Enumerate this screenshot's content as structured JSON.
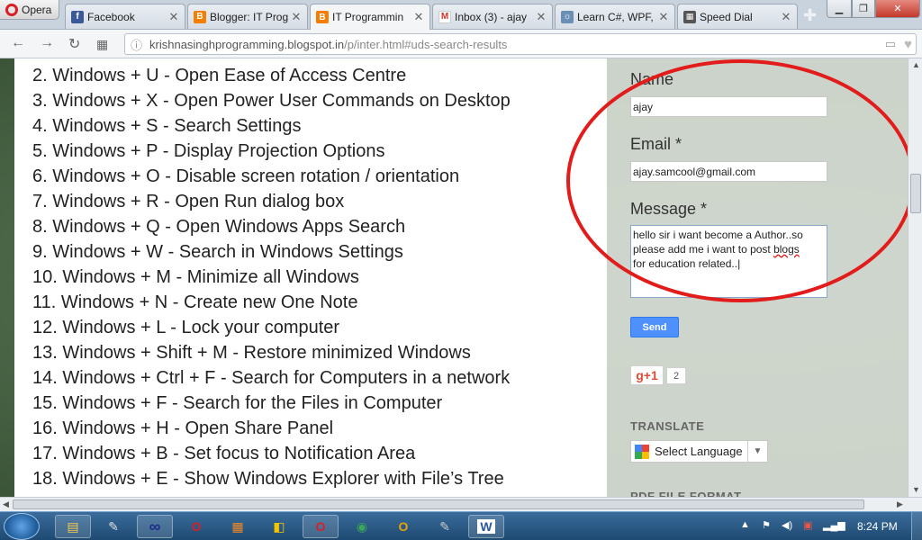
{
  "browser": {
    "menu_label": "Opera",
    "tabs": [
      {
        "label": "Facebook",
        "favicon": "facebook-icon",
        "color": "#3b5998"
      },
      {
        "label": "Blogger: IT Prog",
        "favicon": "blogger-icon",
        "color": "#f57d00"
      },
      {
        "label": "IT Programmin",
        "favicon": "blogger-icon",
        "color": "#f57d00"
      },
      {
        "label": "Inbox (3) - ajay",
        "favicon": "gmail-icon",
        "color": "#d93025"
      },
      {
        "label": "Learn C#, WPF,",
        "favicon": "learn-icon",
        "color": "#6a8fb5"
      },
      {
        "label": "Speed Dial",
        "favicon": "speed-dial-icon",
        "color": "#555555"
      }
    ],
    "active_tab": 2,
    "address": {
      "host": "krishnasinghprogramming.blogspot.in",
      "path": "/p/inter.html#uds-search-results"
    }
  },
  "article": {
    "items": [
      "2. Windows + U - Open Ease of Access Centre",
      "3. Windows + X - Open Power User Commands on Desktop",
      "4. Windows + S - Search Settings",
      "5. Windows + P - Display Projection Options",
      "6. Windows + O - Disable screen rotation / orientation",
      "7. Windows + R - Open Run dialog box",
      "8. Windows + Q - Open Windows Apps Search",
      "9. Windows + W - Search in Windows Settings",
      "10. Windows + M - Minimize all Windows",
      "11. Windows + N - Create new One Note",
      "12. Windows + L - Lock your computer",
      "13. Windows + Shift + M - Restore minimized Windows",
      "14. Windows + Ctrl + F - Search for Computers in a network",
      "15. Windows + F - Search for the Files in Computer",
      "16. Windows + H - Open Share Panel",
      "17. Windows + B - Set focus to Notification Area",
      "18. Windows + E - Show Windows Explorer with File’s Tree"
    ]
  },
  "contact_form": {
    "name_label": "Name",
    "name_value": "ajay",
    "email_label": "Email *",
    "email_value": "ajay.samcool@gmail.com",
    "message_label": "Message *",
    "message_line1": "hello sir i want become a Author..so",
    "message_line2_a": "please add me i want to post ",
    "message_line2_b": "blogs",
    "message_line3": "for education related..",
    "send_label": "Send"
  },
  "social": {
    "gplus_label": "g+1",
    "gplus_count": "2"
  },
  "translate": {
    "heading": "TRANSLATE",
    "select_label": "Select Language"
  },
  "next_section": {
    "heading": "PDF FILE FORMAT"
  },
  "taskbar": {
    "clock": "8:24 PM",
    "apps": [
      {
        "name": "explorer-icon",
        "glyph": "▤",
        "color": "#f2c94c"
      },
      {
        "name": "tool-icon",
        "glyph": "✎",
        "color": "#e0e0e0"
      },
      {
        "name": "infinity-icon",
        "glyph": "∞",
        "color": "#1e2d8c"
      },
      {
        "name": "opera-mini-icon",
        "glyph": "O",
        "color": "#d81f26"
      },
      {
        "name": "media-icon",
        "glyph": "▦",
        "color": "#f08a24"
      },
      {
        "name": "chat-icon",
        "glyph": "◧",
        "color": "#f5c400"
      },
      {
        "name": "opera-icon",
        "glyph": "O",
        "color": "#d81f26"
      },
      {
        "name": "chrome-icon",
        "glyph": "◉",
        "color": "#3aa757"
      },
      {
        "name": "outlook-icon",
        "glyph": "O",
        "color": "#e7a20b"
      },
      {
        "name": "notepad-icon",
        "glyph": "✎",
        "color": "#cccccc"
      },
      {
        "name": "word-icon",
        "glyph": "W",
        "color": "#2b579a"
      }
    ]
  }
}
